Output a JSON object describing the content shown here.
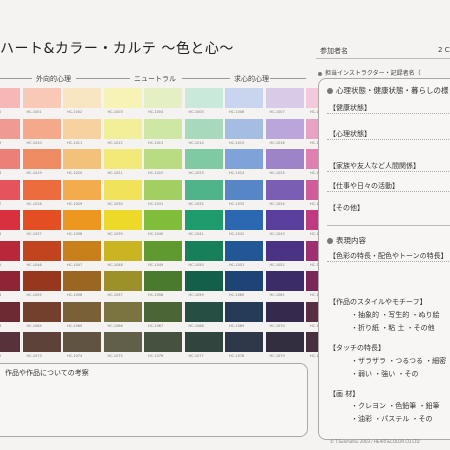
{
  "header": {
    "title": "ハート&カラー・カルテ 〜色と心〜",
    "participant_label": "参加者名",
    "participant_value": "2 C",
    "instructor_label": "担当インストラクター・記録者名（"
  },
  "palette": {
    "group_labels": [
      "外向的心理",
      "ニュートラル",
      "求心的心理"
    ],
    "rows": [
      {
        "codes": [
          "HC-1000",
          "HC-1001",
          "HC-1002",
          "HC-1003",
          "HC-1004",
          "HC-1005",
          "HC-1006",
          "HC-1007",
          "HC-1008"
        ],
        "colors": [
          "#f5b8b6",
          "#f8c9b6",
          "#f8e6c2",
          "#f7f3b5",
          "#e4f0c4",
          "#c9e9da",
          "#c9d5ee",
          "#d7cbe8",
          "#f3c9dc"
        ]
      },
      {
        "codes": [
          "HC-1009",
          "HC-1010",
          "HC-1011",
          "HC-1012",
          "HC-1013",
          "HC-1014",
          "HC-1015",
          "HC-1016",
          "HC-1017"
        ],
        "colors": [
          "#f09a94",
          "#f4a98b",
          "#f5d29f",
          "#f3ee98",
          "#cfe7a5",
          "#a7d9bd",
          "#a5bde3",
          "#baa6d9",
          "#e9a2c5"
        ]
      },
      {
        "codes": [
          "HC-1018",
          "HC-1019",
          "HC-1020",
          "HC-1021",
          "HC-1022",
          "HC-1023",
          "HC-1024",
          "HC-1025",
          "HC-1026"
        ],
        "colors": [
          "#ec7f78",
          "#f08c63",
          "#f3c27a",
          "#f1e978",
          "#b9dc83",
          "#7fc9a3",
          "#7fa3d8",
          "#9d84c9",
          "#df80b0"
        ]
      },
      {
        "codes": [
          "HC-1027",
          "HC-1028",
          "HC-1029",
          "HC-1030",
          "HC-1031",
          "HC-1032",
          "HC-1033",
          "HC-1034",
          "HC-1035"
        ],
        "colors": [
          "#e5545c",
          "#ec6c3e",
          "#f2ac4c",
          "#f0e25a",
          "#a2cf61",
          "#4fb48a",
          "#5786c6",
          "#7a5eb4",
          "#d05c99"
        ]
      },
      {
        "codes": [
          "HC-1036",
          "HC-1037",
          "HC-1038",
          "HC-1039",
          "HC-1040",
          "HC-1041",
          "HC-1042",
          "HC-1043",
          "HC-1044"
        ],
        "colors": [
          "#d9303f",
          "#e44e23",
          "#ec9720",
          "#ecd92a",
          "#7fbd3a",
          "#1e9c6e",
          "#2c68b2",
          "#5b3f9f",
          "#bf3a81"
        ]
      },
      {
        "codes": [
          "HC-1045",
          "HC-1046",
          "HC-1047",
          "HC-1048",
          "HC-1049",
          "HC-1050",
          "HC-1051",
          "HC-1052",
          "HC-1053"
        ],
        "colors": [
          "#b8283a",
          "#c2441e",
          "#c8801a",
          "#c9b522",
          "#5f9a30",
          "#17805a",
          "#225795",
          "#4a3384",
          "#9f3070"
        ]
      },
      {
        "codes": [
          "HC-1054",
          "HC-1055",
          "HC-1056",
          "HC-1057",
          "HC-1058",
          "HC-1059",
          "HC-1060",
          "HC-1061",
          "HC-1062"
        ],
        "colors": [
          "#8e2435",
          "#97371e",
          "#9b6522",
          "#9c9029",
          "#4a7a2d",
          "#135f49",
          "#1d4474",
          "#3b2b66",
          "#7a2657"
        ]
      },
      {
        "codes": [
          "HC-1063",
          "HC-1064",
          "HC-1065",
          "HC-1066",
          "HC-1067",
          "HC-1068",
          "HC-1069",
          "HC-1070",
          "HC-1071"
        ],
        "colors": [
          "#6d2a33",
          "#74402e",
          "#7a6036",
          "#7b7440",
          "#4b6536",
          "#274e42",
          "#263b58",
          "#35294d",
          "#5a2d47"
        ]
      },
      {
        "codes": [
          "HC-1072",
          "HC-1073",
          "HC-1074",
          "HC-1075",
          "HC-1076",
          "HC-1077",
          "HC-1078",
          "HC-1079",
          "HC-1080"
        ],
        "colors": [
          "#58323a",
          "#5c4239",
          "#605342",
          "#615e4a",
          "#45523f",
          "#32443e",
          "#2f3848",
          "#332d40",
          "#482f3d"
        ]
      }
    ]
  },
  "notes": {
    "label": "作品や作品についての考察"
  },
  "right_panel": {
    "section1_title": "心理状態・健康状態・暮らしの様",
    "fields": [
      "【健康状態】",
      "【心理状態】",
      "【家族や友人など人間関係】",
      "【仕事や日々の活動】",
      "【その他】"
    ],
    "section2_title": "表現内容",
    "color_feature": "【色彩の特長・配色やトーンの特長】",
    "style_label": "【作品のスタイルやモチーフ】",
    "style_line1": "・抽象的 ・写生的 ・ぬり絵",
    "style_line2": "・折り紙 ・粘 土 ・その他",
    "touch_label": "【タッチの特長】",
    "touch_line1": "・ザラザラ ・つるつる ・細密",
    "touch_line2": "・弱い ・強い ・その",
    "material_label": "【画 材】",
    "material_line1": "・クレヨン ・色鉛筆 ・鉛筆",
    "material_line2": "・油彩 ・パステル ・その"
  },
  "footer": {
    "copyright": "© T.Suematsu 2003 / HEART&COLOR.CO.LTD"
  }
}
